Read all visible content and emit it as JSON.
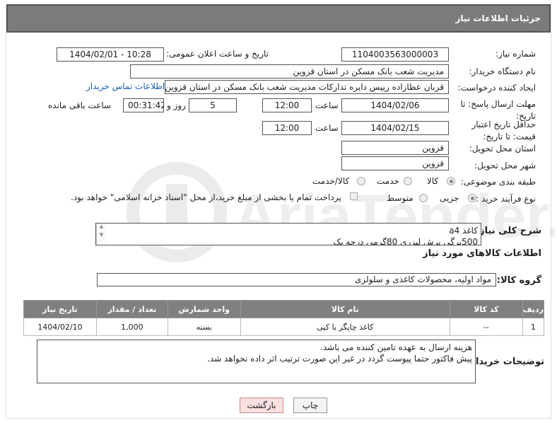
{
  "header": {
    "title": "جزئیات اطلاعات نیاز"
  },
  "fields": {
    "need_number_label": "شماره نیاز:",
    "need_number": "1104003563000003",
    "announce_label": "تاریخ و ساعت اعلان عمومی:",
    "announce_value": "1404/02/01 - 10:28",
    "buyer_org_label": "نام دستگاه خریدار:",
    "buyer_org": "مدیریت شعب بانک مسکن در استان قزوین",
    "creator_label": "ایجاد کننده درخواست:",
    "creator": "قربان عطازاده رییس دایره تدارکات مدیریت شعب بانک مسکن در استان قزوین",
    "contact_link": "اطلاعات تماس خریدار",
    "deadline_label": "مهلت ارسال پاسخ: تا تاریخ:",
    "deadline_date": "1404/02/06",
    "time_label": "ساعت",
    "deadline_time": "12:00",
    "days_value": "5",
    "days_label": "روز و",
    "remaining_time": "00:31:42",
    "remaining_label": "ساعت باقی مانده",
    "validity_label": "حداقل تاریخ اعتبار قیمت: تا تاریخ:",
    "validity_date": "1404/02/15",
    "validity_time": "12:00",
    "province_label": "استان محل تحویل:",
    "province": "قزوین",
    "city_label": "شهر محل تحویل:",
    "city": "قزوین",
    "category_label": "طبقه بندی موضوعی:",
    "cat_goods": "کالا",
    "cat_service": "خدمت",
    "cat_goods_service": "کالا/خدمت",
    "process_label": "نوع فرآیند خرید :",
    "proc_partial": "جزیی",
    "proc_medium": "متوسط",
    "payment_note": "پرداخت تمام یا بخشی از مبلغ خرید،از محل \"اسناد خزانه اسلامی\" خواهد بود."
  },
  "description": {
    "label": "شرح کلی نیاز:",
    "line1": "کاغذ a4",
    "line2": "500برگی  برش لیزری 80گرمی درجه یک"
  },
  "goods_info": {
    "title": "اطلاعات کالاهای مورد نیاز",
    "group_label": "گروه کالا:",
    "group_value": "مواد اولیه، محصولات کاغذی و سلولزی"
  },
  "table": {
    "headers": [
      "ردیف",
      "کد کالا",
      "نام کالا",
      "واحد شمارش",
      "تعداد / مقدار",
      "تاریخ نیاز"
    ],
    "rows": [
      {
        "row": "1",
        "code": "--",
        "name": "کاغذ چاپگر یا کپی",
        "unit": "بسته",
        "qty": "1,000",
        "date": "1404/02/10"
      }
    ]
  },
  "buyer_notes": {
    "label": "توضیحات خریدار:",
    "line1": "هزینه ارسال به عهده تامین کننده می باشد.",
    "line2": "پیش فاکتور  حتما پیوست گردد در غیر این صورت ترتیب اثر داده نخواهد شد."
  },
  "buttons": {
    "print": "چاپ",
    "back": "بازگشت"
  },
  "watermark": {
    "text": "AriaTender.net"
  }
}
